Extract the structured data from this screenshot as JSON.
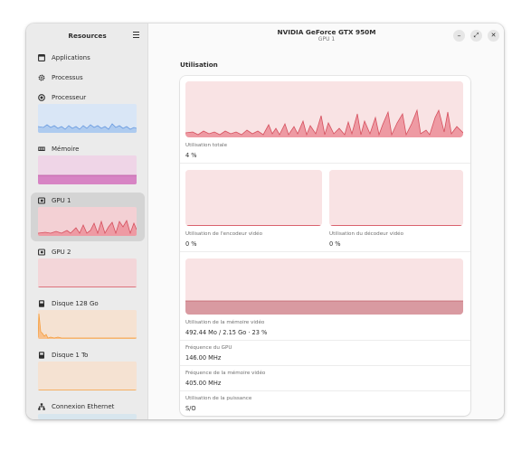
{
  "sidebar": {
    "title": "Resources",
    "items": [
      {
        "label": "Applications"
      },
      {
        "label": "Processus"
      },
      {
        "label": "Processeur"
      },
      {
        "label": "Mémoire"
      },
      {
        "label": "GPU 1"
      },
      {
        "label": "GPU 2"
      },
      {
        "label": "Disque 128 Go"
      },
      {
        "label": "Disque 1 To"
      },
      {
        "label": "Connexion Ethernet"
      }
    ]
  },
  "header": {
    "title": "NVIDIA GeForce GTX 950M",
    "subtitle": "GPU 1",
    "minimize": "–",
    "maximize": "⤢",
    "close": "✕"
  },
  "main": {
    "section_title": "Utilisation",
    "total_usage": {
      "label": "Utilisation totale",
      "value": "4 %"
    },
    "encoder": {
      "label": "Utilisation de l'encodeur vidéo",
      "value": "0 %"
    },
    "decoder": {
      "label": "Utilisation du décodeur vidéo",
      "value": "0 %"
    },
    "memory": {
      "label": "Utilisation de la mémoire vidéo",
      "value": "492.44 Mo / 2.15 Go · 23 %"
    },
    "gpu_freq": {
      "label": "Fréquence du GPU",
      "value": "146.00 MHz"
    },
    "mem_freq": {
      "label": "Fréquence de la mémoire vidéo",
      "value": "405.00 MHz"
    },
    "power": {
      "label": "Utilisation de la puissance",
      "value": "S/O"
    }
  },
  "colors": {
    "gpu_fill": "#ee9aa3",
    "gpu_line": "#d5505e",
    "gpu_bg": "#f9e3e4",
    "cpu_fill": "#aecbef",
    "mem_fill": "#d784c4",
    "disk_line": "#f59e3e"
  }
}
